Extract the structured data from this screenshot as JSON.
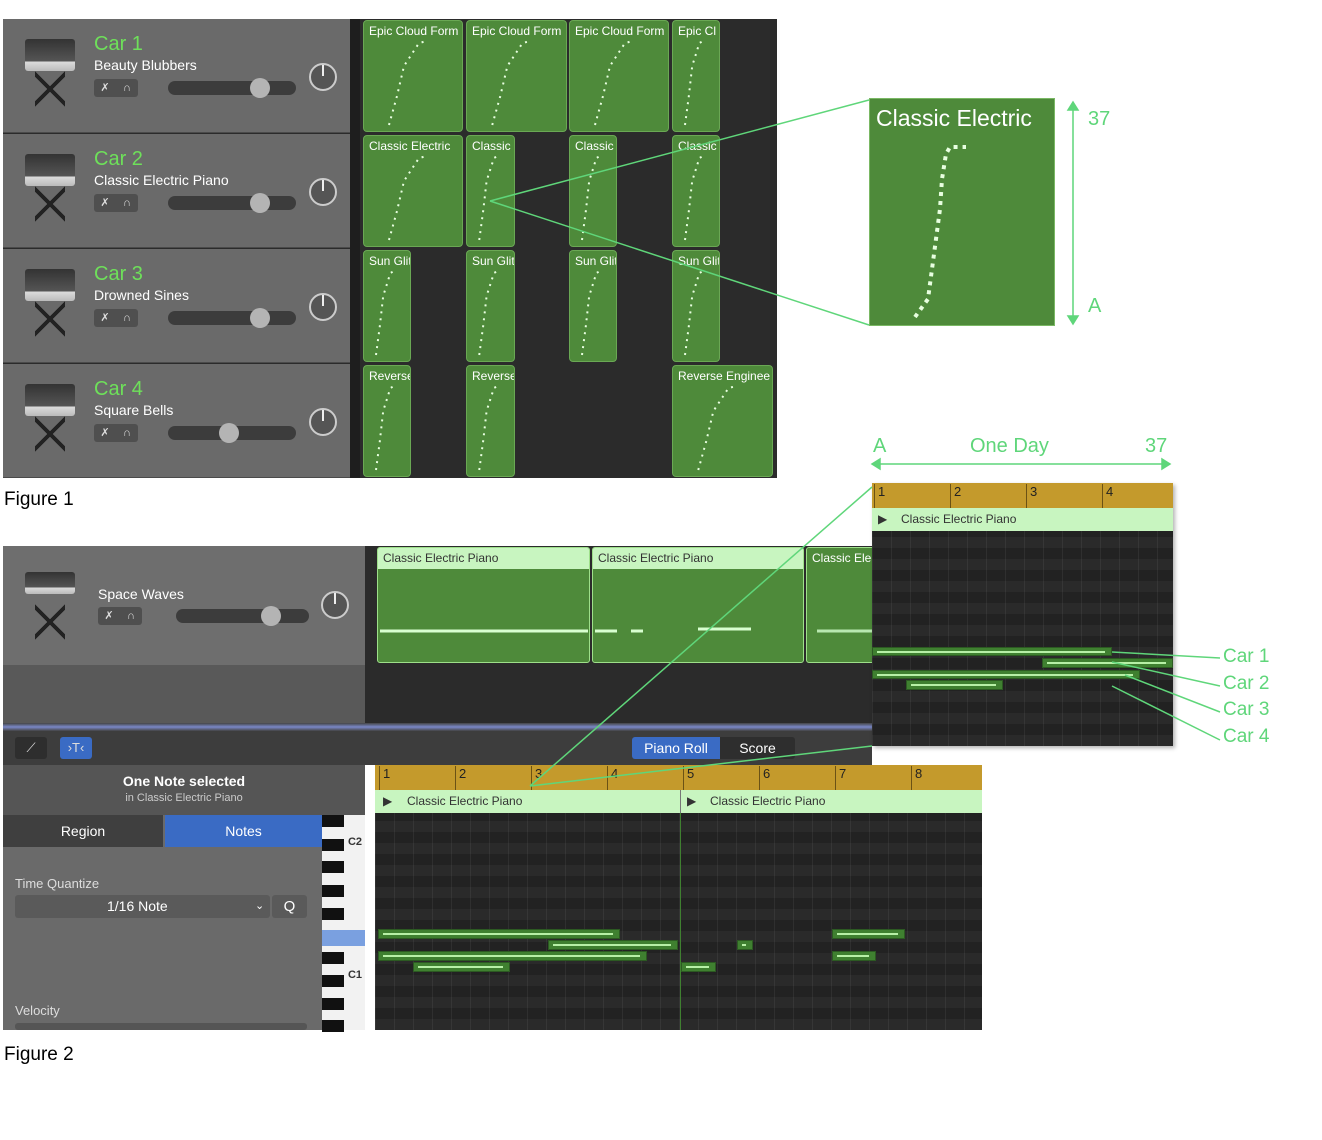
{
  "figure1": {
    "caption": "Figure 1",
    "tracks": [
      {
        "name": "Car 1",
        "instrument": "Beauty Blubbers",
        "volume": 0.72
      },
      {
        "name": "Car 2",
        "instrument": "Classic Electric Piano",
        "volume": 0.72
      },
      {
        "name": "Car 3",
        "instrument": "Drowned Sines",
        "volume": 0.72
      },
      {
        "name": "Car 4",
        "instrument": "Square Bells",
        "volume": 0.48
      }
    ],
    "regions": [
      [
        "Epic Cloud Form",
        "Epic Cloud Form",
        "Epic Cloud Form",
        "Epic Cl"
      ],
      [
        "Classic Electric",
        "Classic",
        "Classic",
        "Classic"
      ],
      [
        "Sun Glit",
        "Sun Glit",
        "Sun Glit",
        "Sun Glit"
      ],
      [
        "Reverse",
        "Reverse",
        "",
        "Reverse Enginee"
      ]
    ],
    "zoom": {
      "title": "Classic Electric",
      "top_label": "37",
      "bottom_label": "A"
    }
  },
  "figure2": {
    "caption": "Figure 2",
    "track": {
      "instrument": "Space Waves",
      "volume": 0.73
    },
    "regions": [
      "Classic Electric Piano",
      "Classic Electric Piano",
      "Classic Ele"
    ],
    "toolbar": {
      "piano_roll": "Piano Roll",
      "score": "Score"
    },
    "inspector": {
      "title": "One Note selected",
      "subtitle": "in Classic Electric Piano",
      "tab_region": "Region",
      "tab_notes": "Notes",
      "time_quantize_label": "Time Quantize",
      "time_quantize_value": "1/16 Note",
      "q_button": "Q",
      "velocity_label": "Velocity"
    },
    "keys": {
      "c2": "C2",
      "c1": "C1"
    },
    "ruler": [
      "1",
      "2",
      "3",
      "4",
      "5",
      "6",
      "7",
      "8"
    ],
    "roll_regions": [
      "Classic Electric Piano",
      "Classic Electric Piano"
    ],
    "zoom": {
      "ruler": [
        "1",
        "2",
        "3",
        "4"
      ],
      "region": "Classic Electric Piano",
      "axis_left": "A",
      "axis_mid": "One Day",
      "axis_right": "37"
    },
    "callouts": [
      "Car 1",
      "Car 2",
      "Car 3",
      "Car 4"
    ]
  },
  "colors": {
    "accent": "#5fd67a",
    "region": "#4e8a3a",
    "ruler": "#c49a2c",
    "selected": "#3a6bc4"
  }
}
